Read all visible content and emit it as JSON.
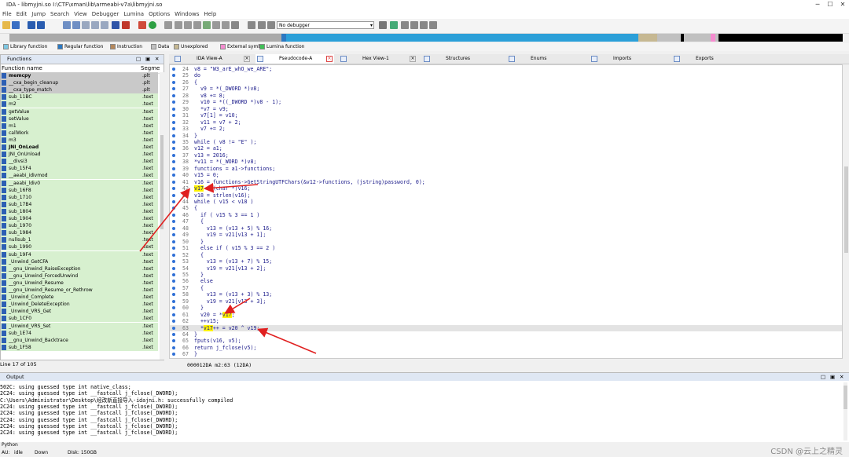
{
  "window": {
    "title": "IDA - libmyjni.so I:\\CTF\\xman\\lib\\armeabi-v7a\\libmyjni.so"
  },
  "menu": [
    "File",
    "Edit",
    "Jump",
    "Search",
    "View",
    "Debugger",
    "Lumina",
    "Options",
    "Windows",
    "Help"
  ],
  "toolbar": {
    "debugger_select": "No debugger"
  },
  "legend": [
    {
      "label": "Library function",
      "color": "#7ec8e3"
    },
    {
      "label": "Regular function",
      "color": "#2b78c2"
    },
    {
      "label": "Instruction",
      "color": "#b5885c"
    },
    {
      "label": "Data",
      "color": "#c0c0c0"
    },
    {
      "label": "Unexplored",
      "color": "#c6b892"
    },
    {
      "label": "External symbol",
      "color": "#f48ccf"
    },
    {
      "label": "Lumina function",
      "color": "#40c057"
    }
  ],
  "functions_panel": {
    "title": "Functions",
    "col_name": "Function name",
    "col_segment": "Segme",
    "rows": [
      {
        "name": "memcpy",
        "seg": ".plt",
        "bold": true,
        "sel": true
      },
      {
        "name": "__cxa_begin_cleanup",
        "seg": ".plt",
        "sel": true
      },
      {
        "name": "__cxa_type_match",
        "seg": ".plt",
        "sel": true
      },
      {
        "name": "sub_11BC",
        "seg": ".text"
      },
      {
        "name": "m2",
        "seg": ".text"
      },
      {
        "name": "getValue",
        "seg": ".text"
      },
      {
        "name": "setValue",
        "seg": ".text"
      },
      {
        "name": "m1",
        "seg": ".text"
      },
      {
        "name": "callWork",
        "seg": ".text"
      },
      {
        "name": "m3",
        "seg": ".text"
      },
      {
        "name": "JNI_OnLoad",
        "seg": ".text",
        "bold": true
      },
      {
        "name": "JNI_OnUnload",
        "seg": ".text"
      },
      {
        "name": "__divsi3",
        "seg": ".text"
      },
      {
        "name": "sub_15F4",
        "seg": ".text"
      },
      {
        "name": "__aeabi_idivmod",
        "seg": ".text"
      },
      {
        "name": "__aeabi_ldiv0",
        "seg": ".text"
      },
      {
        "name": "sub_16F8",
        "seg": ".text"
      },
      {
        "name": "sub_1710",
        "seg": ".text"
      },
      {
        "name": "sub_17B4",
        "seg": ".text"
      },
      {
        "name": "sub_1804",
        "seg": ".text"
      },
      {
        "name": "sub_1904",
        "seg": ".text"
      },
      {
        "name": "sub_1970",
        "seg": ".text"
      },
      {
        "name": "sub_1984",
        "seg": ".text"
      },
      {
        "name": "nullsub_1",
        "seg": ".text"
      },
      {
        "name": "sub_1990",
        "seg": ".text"
      },
      {
        "name": "sub_19F4",
        "seg": ".text"
      },
      {
        "name": "_Unwind_GetCFA",
        "seg": ".text"
      },
      {
        "name": "__gnu_Unwind_RaiseException",
        "seg": ".text"
      },
      {
        "name": "__gnu_Unwind_ForcedUnwind",
        "seg": ".text"
      },
      {
        "name": "__gnu_Unwind_Resume",
        "seg": ".text"
      },
      {
        "name": "__gnu_Unwind_Resume_or_Rethrow",
        "seg": ".text"
      },
      {
        "name": "_Unwind_Complete",
        "seg": ".text"
      },
      {
        "name": "_Unwind_DeleteException",
        "seg": ".text"
      },
      {
        "name": "_Unwind_VRS_Get",
        "seg": ".text"
      },
      {
        "name": "sub_1CF0",
        "seg": ".text"
      },
      {
        "name": "_Unwind_VRS_Set",
        "seg": ".text"
      },
      {
        "name": "sub_1E74",
        "seg": ".text"
      },
      {
        "name": "__gnu_Unwind_Backtrace",
        "seg": ".text"
      },
      {
        "name": "sub_1F58",
        "seg": ".text"
      }
    ],
    "line_status": "Line 17 of 105"
  },
  "tabs": [
    {
      "label": "IDA View-A"
    },
    {
      "label": "Pseudocode-A",
      "active": true
    },
    {
      "label": "Hex View-1"
    },
    {
      "label": "Structures"
    },
    {
      "label": "Enums"
    },
    {
      "label": "Imports"
    },
    {
      "label": "Exports"
    }
  ],
  "code_lines": [
    {
      "n": "24",
      "t": "v8 = \"W3_arE_whO_we_ARE\";"
    },
    {
      "n": "25",
      "t": "do"
    },
    {
      "n": "26",
      "t": "{"
    },
    {
      "n": "27",
      "t": "  v9 = *(_DWORD *)v8;"
    },
    {
      "n": "28",
      "t": "  v8 += 8;"
    },
    {
      "n": "29",
      "t": "  v10 = *((_DWORD *)v8 - 1);"
    },
    {
      "n": "30",
      "t": "  *v7 = v9;"
    },
    {
      "n": "31",
      "t": "  v7[1] = v10;"
    },
    {
      "n": "32",
      "t": "  v11 = v7 + 2;"
    },
    {
      "n": "33",
      "t": "  v7 += 2;"
    },
    {
      "n": "34",
      "t": "}"
    },
    {
      "n": "35",
      "t": "while ( v8 != \"E\" );"
    },
    {
      "n": "36",
      "t": "v12 = a1;"
    },
    {
      "n": "37",
      "t": "v13 = 2016;"
    },
    {
      "n": "38",
      "t": "*v11 = *(_WORD *)v8;"
    },
    {
      "n": "39",
      "t": "functions = a1->functions;"
    },
    {
      "n": "40",
      "t": "v15 = 0;"
    },
    {
      "n": "41",
      "t": "v16 = functions->GetStringUTFChars(&v12->functions, (jstring)password, 0);"
    },
    {
      "n": "42",
      "pre": "",
      "hl": "v17",
      "post": " = (char *)v16;"
    },
    {
      "n": "43",
      "t": "v18 = strlen(v16);"
    },
    {
      "n": "44",
      "t": "while ( v15 < v18 )"
    },
    {
      "n": "45",
      "t": "{"
    },
    {
      "n": "46",
      "t": "  if ( v15 % 3 == 1 )"
    },
    {
      "n": "47",
      "t": "  {"
    },
    {
      "n": "48",
      "t": "    v13 = (v13 + 5) % 16;"
    },
    {
      "n": "49",
      "t": "    v19 = v21[v13 + 1];"
    },
    {
      "n": "50",
      "t": "  }"
    },
    {
      "n": "51",
      "t": "  else if ( v15 % 3 == 2 )"
    },
    {
      "n": "52",
      "t": "  {"
    },
    {
      "n": "53",
      "t": "    v13 = (v13 + 7) % 15;"
    },
    {
      "n": "54",
      "t": "    v19 = v21[v13 + 2];"
    },
    {
      "n": "55",
      "t": "  }"
    },
    {
      "n": "56",
      "t": "  else"
    },
    {
      "n": "57",
      "t": "  {"
    },
    {
      "n": "58",
      "t": "    v13 = (v13 + 3) % 13;"
    },
    {
      "n": "59",
      "t": "    v19 = v21[v13 + 3];"
    },
    {
      "n": "60",
      "t": "  }"
    },
    {
      "n": "61",
      "pre": "  v20 = *",
      "hl": "v17",
      "post": ";"
    },
    {
      "n": "62",
      "t": "  ++v15;"
    },
    {
      "n": "63",
      "pre": "  *",
      "hl": "v17",
      "post": "++ = v20 ^ v19;",
      "row": true
    },
    {
      "n": "64",
      "t": "}"
    },
    {
      "n": "65",
      "t": "fputs(v16, v5);"
    },
    {
      "n": "66",
      "t": "return j_fclose(v5);"
    },
    {
      "n": "67",
      "t": "}"
    }
  ],
  "code_status": "000012DA m2:63 (12DA)",
  "output": {
    "title": "Output",
    "lines": [
      "502C: using guessed type int native_class;",
      "2C24: using guessed type int __fastcall j_fclose(_DWORD);",
      "C:\\Users\\Administrator\\Desktop\\经改新直接导入-idajni.h: successfully compiled",
      "2C24: using guessed type int __fastcall j_fclose(_DWORD);",
      "2C24: using guessed type int __fastcall j_fclose(_DWORD);",
      "2C24: using guessed type int __fastcall j_fclose(_DWORD);",
      "2C24: using guessed type int __fastcall j_fclose(_DWORD);",
      "2C24: using guessed type int __fastcall j_fclose(_DWORD);"
    ]
  },
  "python_label": "Python",
  "status": {
    "au": "AU:",
    "state": "idle",
    "dir": "Down",
    "disk": "Disk: 150GB"
  },
  "watermark": "CSDN @云上之精灵"
}
